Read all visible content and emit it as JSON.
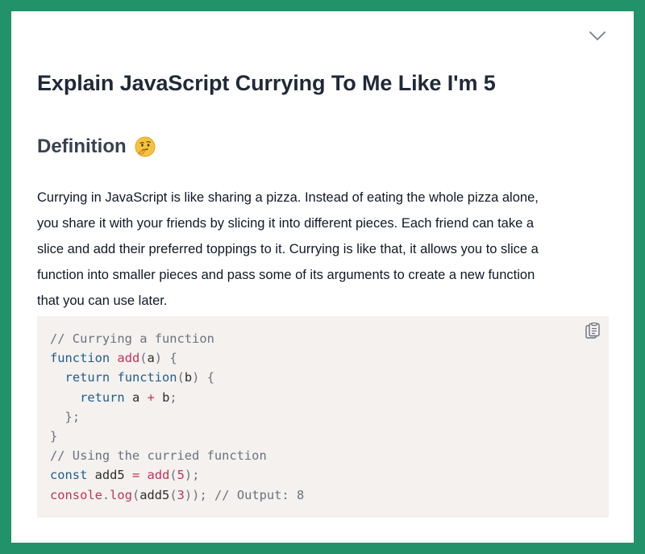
{
  "article": {
    "title": "Explain JavaScript Currying To Me Like I'm 5",
    "subtitle": "Definition",
    "emoji_icon": "thinking-face-icon",
    "paragraph_lines": [
      "Currying in JavaScript is like sharing a pizza. Instead of eating the whole pizza alone,",
      "you share it with your friends by slicing it into different pieces. Each friend can take a",
      "slice and add their preferred toppings to it. Currying is like that, it allows you to slice a",
      "function into smaller pieces and pass some of its arguments to create a new function",
      "that you can use later."
    ]
  },
  "code": {
    "language": "javascript",
    "lines": [
      "// Currying a function",
      "function add(a) {",
      "  return function(b) {",
      "    return a + b;",
      "  };",
      "}",
      "// Using the curried function",
      "const add5 = add(5);",
      "console.log(add5(3)); // Output: 8"
    ]
  },
  "colors": {
    "background": "#22926a",
    "card": "#ffffff",
    "code_background": "#f4f1ee",
    "keyword": "#1d5e8c",
    "function": "#c0345a",
    "comment": "#6b7280"
  },
  "icons": {
    "collapse": "chevron-down-icon",
    "copy": "clipboard-copy-icon"
  }
}
